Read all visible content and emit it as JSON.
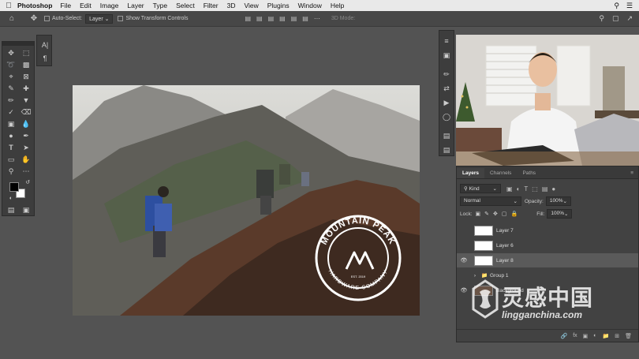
{
  "menubar": {
    "app_name": "Photoshop",
    "items": [
      "File",
      "Edit",
      "Image",
      "Layer",
      "Type",
      "Select",
      "Filter",
      "3D",
      "View",
      "Plugins",
      "Window",
      "Help"
    ]
  },
  "options_bar": {
    "auto_select_label": "Auto-Select:",
    "auto_select_value": "Layer",
    "show_transform_label": "Show Transform Controls",
    "mode_3d_label": "3D Mode:"
  },
  "canvas": {
    "logo_text_top": "MOUNTAIN PEAK",
    "logo_text_bottom": "HARDWARE COMPANY",
    "logo_est": "EST. 2019"
  },
  "layers_panel": {
    "tabs": [
      "Layers",
      "Channels",
      "Paths"
    ],
    "filter_kind": "Kind",
    "blend_mode": "Normal",
    "opacity_label": "Opacity:",
    "opacity_value": "100%",
    "lock_label": "Lock:",
    "fill_label": "Fill:",
    "fill_value": "100%",
    "layers": [
      {
        "name": "Layer 7",
        "visible": false,
        "selected": false
      },
      {
        "name": "Layer 6",
        "visible": false,
        "selected": false
      },
      {
        "name": "Layer 8",
        "visible": true,
        "selected": true
      },
      {
        "name": "Group 1",
        "visible": false,
        "selected": false
      },
      {
        "name": "Background",
        "visible": true,
        "selected": false
      }
    ]
  },
  "watermark": {
    "chinese": "灵感中国",
    "url": "lingganchina.com"
  },
  "colors": {
    "ui_bg": "#535353",
    "panel_bg": "#424242",
    "selected_layer": "#5a5a5a"
  }
}
